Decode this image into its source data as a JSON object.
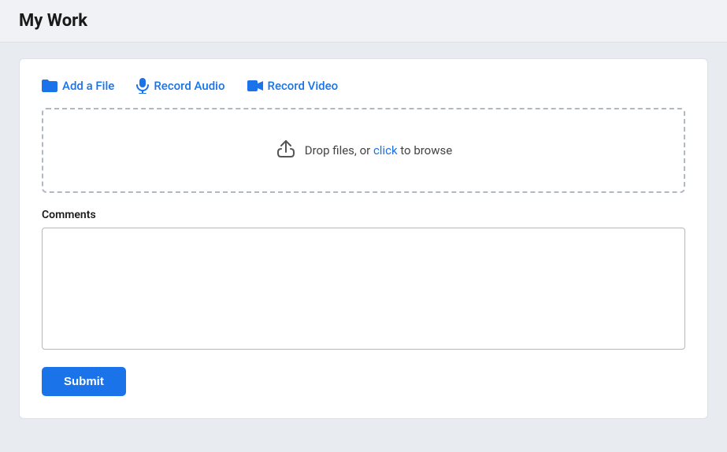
{
  "page": {
    "title": "My Work"
  },
  "tabs": [
    {
      "id": "add-file",
      "label": "Add a File",
      "icon": "folder-icon"
    },
    {
      "id": "record-audio",
      "label": "Record Audio",
      "icon": "mic-icon"
    },
    {
      "id": "record-video",
      "label": "Record Video",
      "icon": "video-icon"
    }
  ],
  "dropzone": {
    "text": "Drop files, or ",
    "link_text": "click",
    "text_after": " to browse"
  },
  "comments": {
    "label": "Comments",
    "placeholder": ""
  },
  "submit": {
    "label": "Submit"
  }
}
